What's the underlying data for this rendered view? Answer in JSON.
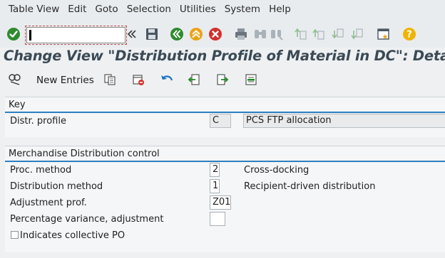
{
  "menu": [
    "Table View",
    "Edit",
    "Goto",
    "Selection",
    "Utilities",
    "System",
    "Help"
  ],
  "toolbar": {
    "icons": [
      "enter-icon",
      "command-field",
      "collapse-icon",
      "save-icon",
      "back-icon",
      "exit-icon",
      "cancel-icon",
      "print-icon",
      "find-icon",
      "find-next-icon",
      "first-page-icon",
      "previous-page-icon",
      "next-page-icon",
      "last-page-icon",
      "create-session-icon",
      "help-icon"
    ],
    "command_value": ""
  },
  "title": "Change View \"Distribution Profile of Material in DC\": Details",
  "app_toolbar": {
    "new_entries": "New Entries"
  },
  "key_group": {
    "title": "Key",
    "distr_profile_label": "Distr. profile",
    "distr_profile_value": "C",
    "distr_profile_text": "PCS FTP allocation"
  },
  "mdc_group": {
    "title": "Merchandise Distribution control",
    "proc_method_label": "Proc. method",
    "proc_method_value": "2",
    "proc_method_text": "Cross-docking",
    "dist_method_label": "Distribution method",
    "dist_method_value": "1",
    "dist_method_text": "Recipient-driven distribution",
    "adj_prof_label": "Adjustment prof.",
    "adj_prof_value": "Z01",
    "pct_var_label": "Percentage variance, adjustment",
    "pct_var_value": "",
    "collective_po_label": "Indicates collective PO",
    "collective_po_checked": false
  }
}
